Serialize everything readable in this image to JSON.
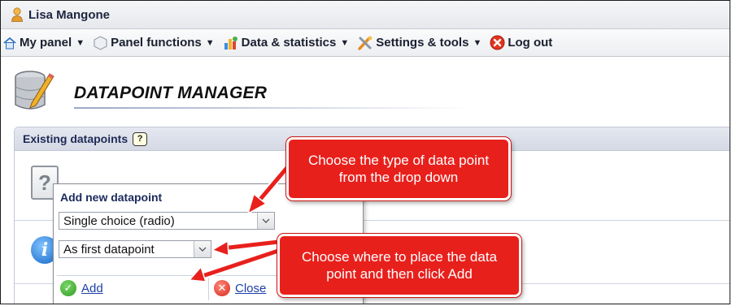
{
  "user": {
    "name": "Lisa Mangone"
  },
  "nav": {
    "items": [
      {
        "label": "My panel",
        "icon": "home-icon"
      },
      {
        "label": "Panel functions",
        "icon": "hexagon-icon"
      },
      {
        "label": "Data & statistics",
        "icon": "chart-icon"
      },
      {
        "label": "Settings & tools",
        "icon": "tools-icon"
      },
      {
        "label": "Log out",
        "icon": "close-circle-icon"
      }
    ]
  },
  "page": {
    "title": "DATAPOINT MANAGER"
  },
  "panel": {
    "title": "Existing datapoints",
    "help": "?"
  },
  "popup": {
    "title": "Add new datapoint",
    "type_select": {
      "value": "Single choice (radio)"
    },
    "position_select": {
      "value": "As first datapoint"
    },
    "add_label": "Add",
    "close_label": "Close"
  },
  "callouts": {
    "type_hint": "Choose the type of data point from the drop down",
    "position_hint": "Choose where to place the data point and then click Add"
  },
  "colors": {
    "callout": "#e8201c",
    "link": "#1c3fa8",
    "title_text": "#1e2a58"
  }
}
